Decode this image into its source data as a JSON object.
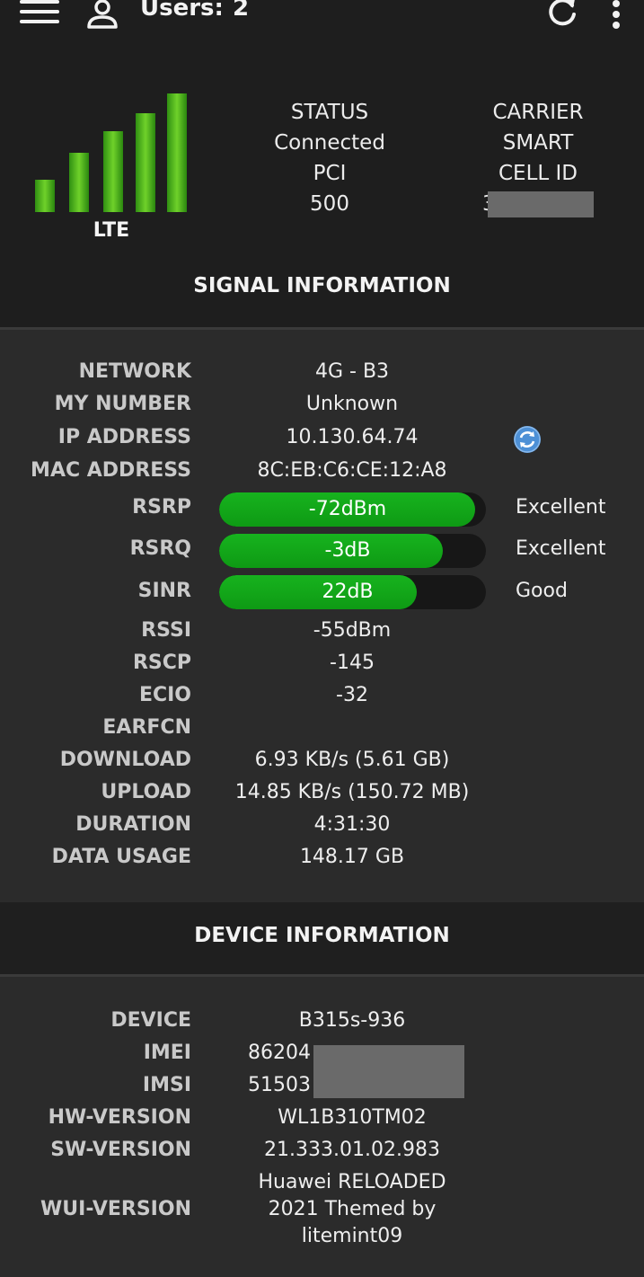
{
  "header": {
    "users_label": "Users:",
    "users_count": "2"
  },
  "signal": {
    "network_type": "LTE",
    "bars_filled": 5,
    "bars_total": 5
  },
  "status": {
    "status_label": "STATUS",
    "status_value": "Connected",
    "pci_label": "PCI",
    "pci_value": "500",
    "carrier_label": "CARRIER",
    "carrier_value": "SMART",
    "cell_id_label": "CELL ID",
    "cell_id_value": "3"
  },
  "signal_section": {
    "title": "SIGNAL INFORMATION",
    "network_label": "NETWORK",
    "network_value": "4G - B3",
    "my_number_label": "MY NUMBER",
    "my_number_value": "Unknown",
    "ip_label": "IP ADDRESS",
    "ip_value": "10.130.64.74",
    "mac_label": "MAC ADDRESS",
    "mac_value": "8C:EB:C6:CE:12:A8",
    "rsrp_label": "RSRP",
    "rsrp_value": "-72dBm",
    "rsrp_quality": "Excellent",
    "rsrp_level": 0.96,
    "rsrq_label": "RSRQ",
    "rsrq_value": "-3dB",
    "rsrq_quality": "Excellent",
    "rsrq_level": 0.84,
    "sinr_label": "SINR",
    "sinr_value": "22dB",
    "sinr_quality": "Good",
    "sinr_level": 0.74,
    "rssi_label": "RSSI",
    "rssi_value": "-55dBm",
    "rscp_label": "RSCP",
    "rscp_value": "-145",
    "ecio_label": "ECIO",
    "ecio_value": "-32",
    "earfcn_label": "EARFCN",
    "earfcn_value": "",
    "download_label": "DOWNLOAD",
    "download_value": "6.93 KB/s (5.61 GB)",
    "upload_label": "UPLOAD",
    "upload_value": "14.85 KB/s (150.72 MB)",
    "duration_label": "DURATION",
    "duration_value": "4:31:30",
    "data_usage_label": "DATA USAGE",
    "data_usage_value": "148.17 GB"
  },
  "device_section": {
    "title": "DEVICE INFORMATION",
    "device_label": "DEVICE",
    "device_value": "B315s-936",
    "imei_label": "IMEI",
    "imei_value": "86204",
    "imsi_label": "IMSI",
    "imsi_value": "51503",
    "hw_label": "HW-VERSION",
    "hw_value": "WL1B310TM02",
    "sw_label": "SW-VERSION",
    "sw_value": "21.333.01.02.983",
    "wui_label": "WUI-VERSION",
    "wui_line1": "Huawei RELOADED",
    "wui_line2": "2021 Themed by",
    "wui_line3": "litemint09"
  },
  "colors": {
    "bar_green": "#12a818",
    "background": "#1e1e1e",
    "panel": "#2b2b2b",
    "ip_refresh_icon": "#4d90d6"
  },
  "icons": {
    "menu": "hamburger-menu-icon",
    "user": "user-icon",
    "refresh": "refresh-icon",
    "more": "more-vertical-icon",
    "ip_refresh": "ip-refresh-icon"
  }
}
